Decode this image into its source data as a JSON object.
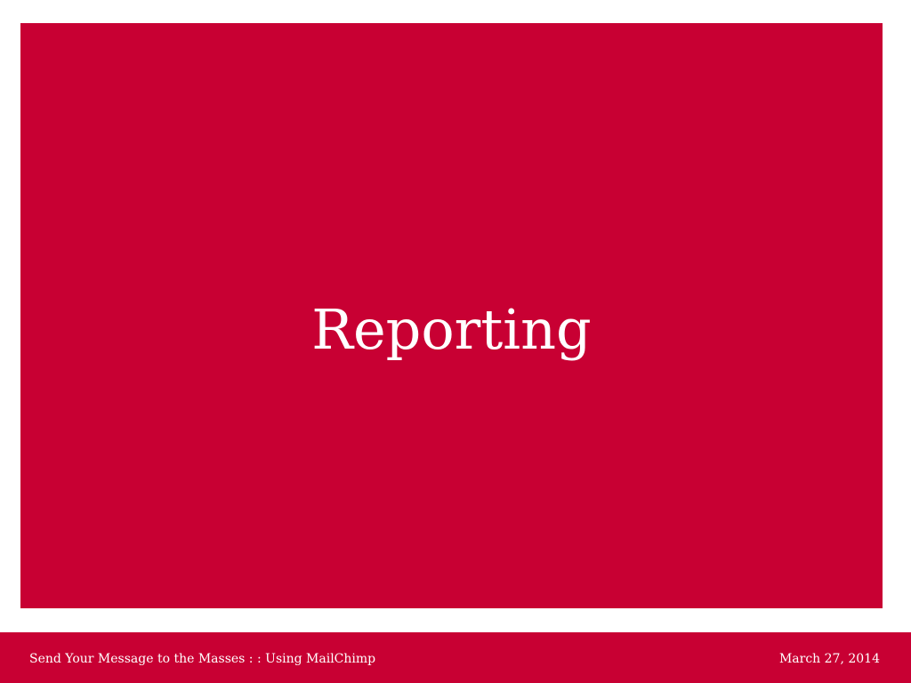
{
  "slide": {
    "title": "Reporting",
    "footer_left": "Send Your Message to the Masses  : :   Using MailChimp",
    "footer_right": "March 27, 2014"
  },
  "colors": {
    "accent": "#c80033",
    "background": "#ffffff",
    "text_on_accent": "#ffffff"
  }
}
